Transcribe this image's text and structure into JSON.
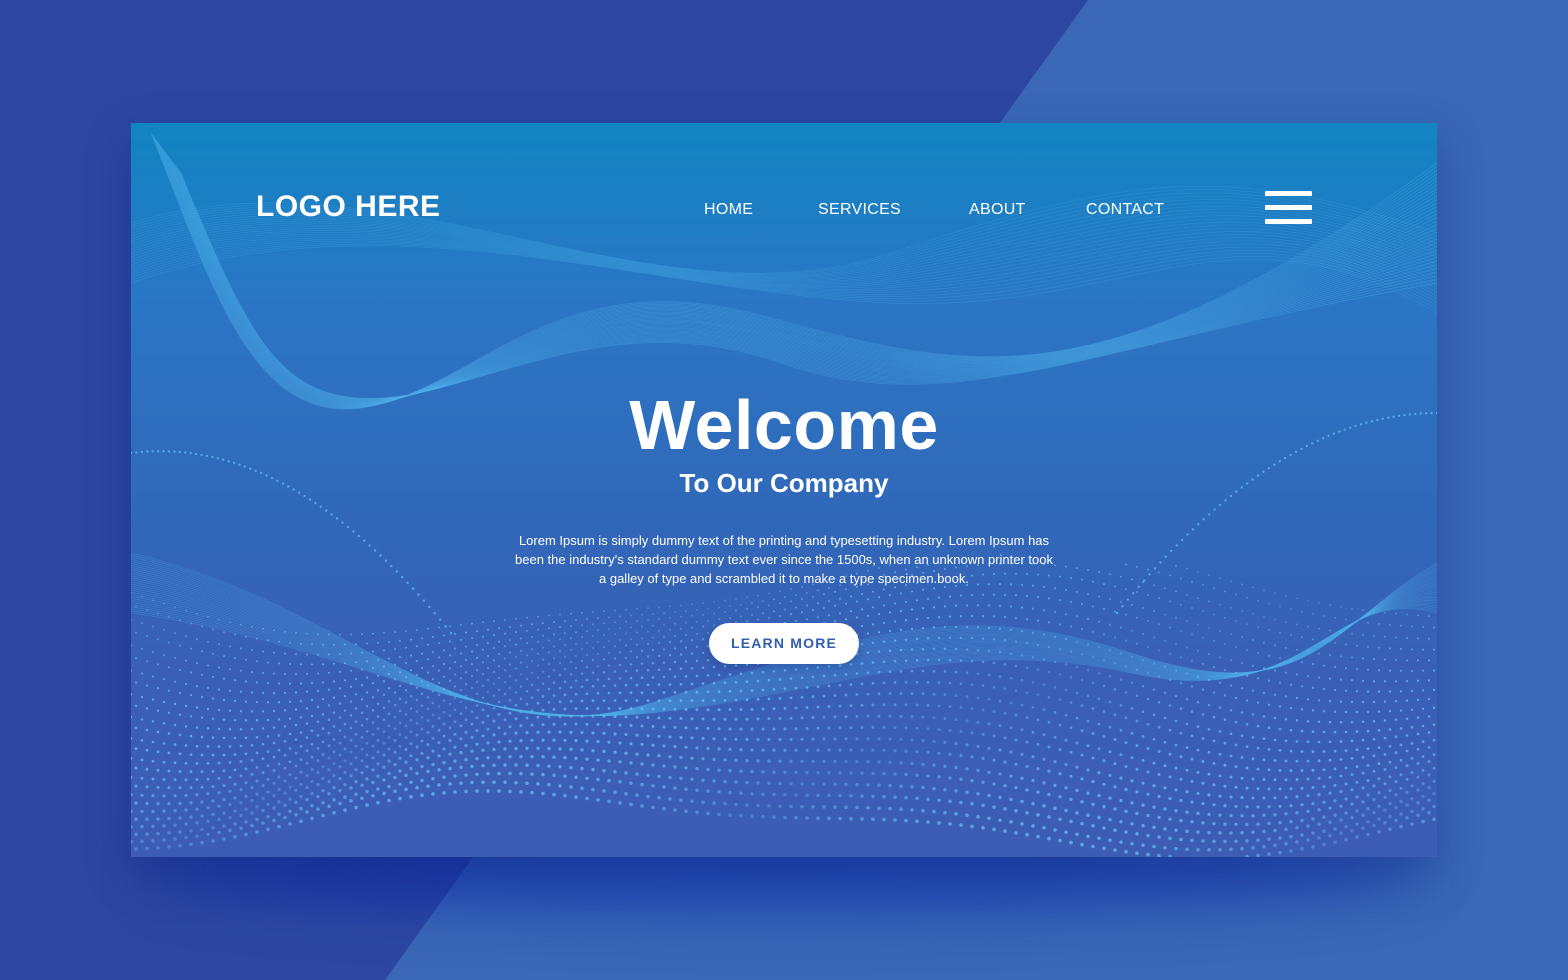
{
  "colors": {
    "backdrop_dark": "#2d47a0",
    "backdrop_light": "#3a68b6",
    "card_top": "#1184c2",
    "card_bottom": "#3d5cb4",
    "wave_lines": "#4fb3ea",
    "dots": "#62c2f5",
    "text": "#ffffff",
    "cta_text": "#2f5fae"
  },
  "header": {
    "logo": "LOGO HERE",
    "nav": {
      "home": "HOME",
      "services": "SERVICES",
      "about": "ABOUT",
      "contact": "CONTACT"
    },
    "menu_icon": "hamburger-menu-icon"
  },
  "hero": {
    "title": "Welcome",
    "subtitle": "To Our Company",
    "body": "Lorem Ipsum is simply dummy text of the printing and typesetting industry. Lorem Ipsum has been the industry's standard dummy text ever since the 1500s, when an unknown printer took a galley of type and scrambled it to make a type specimen.book.",
    "cta_label": "LEARN MORE"
  }
}
